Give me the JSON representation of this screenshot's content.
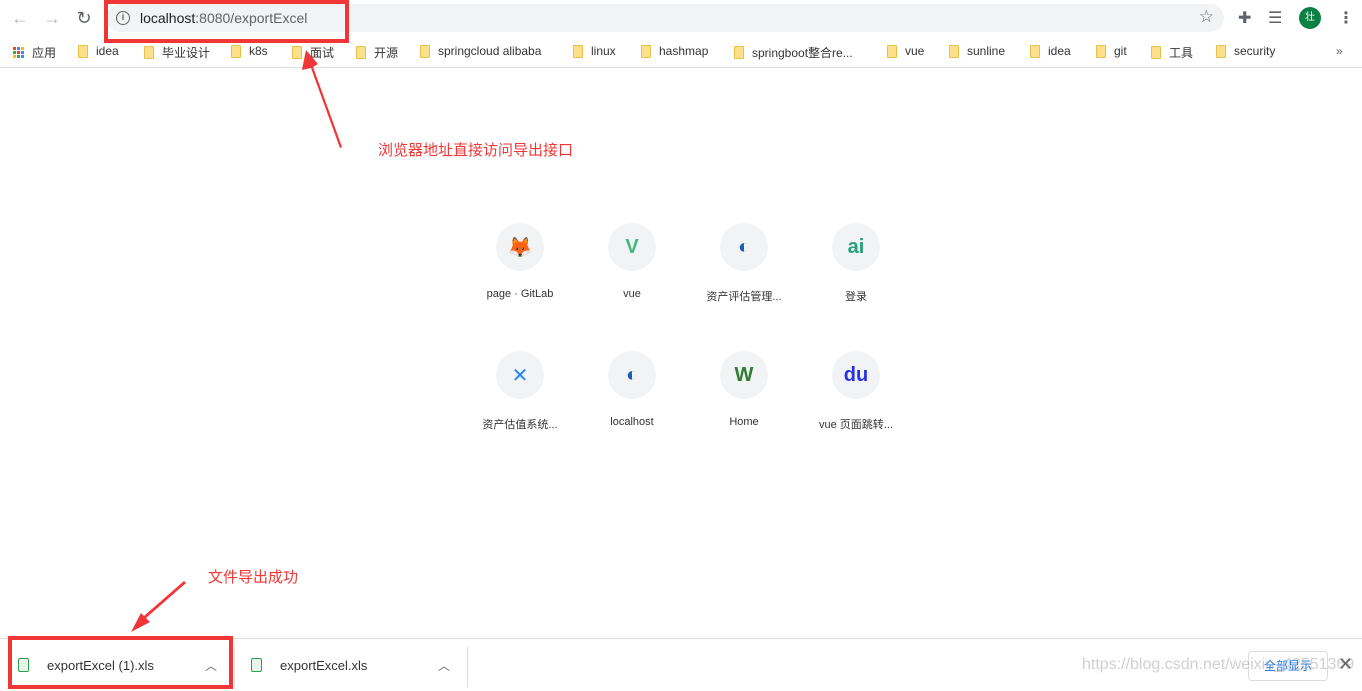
{
  "browser": {
    "address_host": "localhost",
    "address_rest": ":8080/exportExcel",
    "avatar_initial": "壮",
    "icons": [
      "back-arrow-icon",
      "forward-arrow-icon",
      "reload-icon",
      "info-icon",
      "star-icon",
      "extensions-puzzle-icon",
      "media-queue-icon",
      "kebab-menu-icon"
    ]
  },
  "bookmarks": {
    "apps_label": "应用",
    "items": [
      "idea",
      "毕业设计",
      "k8s",
      "面试",
      "开源",
      "springcloud alibaba",
      "linux",
      "hashmap",
      "springboot整合re...",
      "vue",
      "sunline",
      "idea",
      "git",
      "工具",
      "security"
    ],
    "overflow": "»"
  },
  "shortcuts": [
    {
      "label": "page · GitLab",
      "icon": "gitlab-icon",
      "color": "#e24329"
    },
    {
      "label": "vue",
      "icon": "vue-icon",
      "color": "#41b883"
    },
    {
      "label": "资产评估管理...",
      "icon": "globe-icon",
      "color": "#1b5fae"
    },
    {
      "label": "登录",
      "icon": "ai-logo-icon",
      "color": "#26a17b"
    },
    {
      "label": "资产估值系统...",
      "icon": "confluence-icon",
      "color": "#2684ff"
    },
    {
      "label": "localhost",
      "icon": "globe-icon",
      "color": "#1b5fae"
    },
    {
      "label": "Home",
      "icon": "w-logo-icon",
      "color": "#2e7d32"
    },
    {
      "label": "vue 页面跳转...",
      "icon": "baidu-paw-icon",
      "color": "#2932e1"
    }
  ],
  "downloads": {
    "items": [
      {
        "name": "exportExcel (1).xls"
      },
      {
        "name": "exportExcel.xls"
      }
    ],
    "show_all": "全部显示",
    "close": "✕"
  },
  "annotations": {
    "address_note": "浏览器地址直接访问导出接口",
    "download_note": "文件导出成功",
    "color": "#f03636"
  },
  "watermark": "https://blog.csdn.net/weixin_42551369"
}
